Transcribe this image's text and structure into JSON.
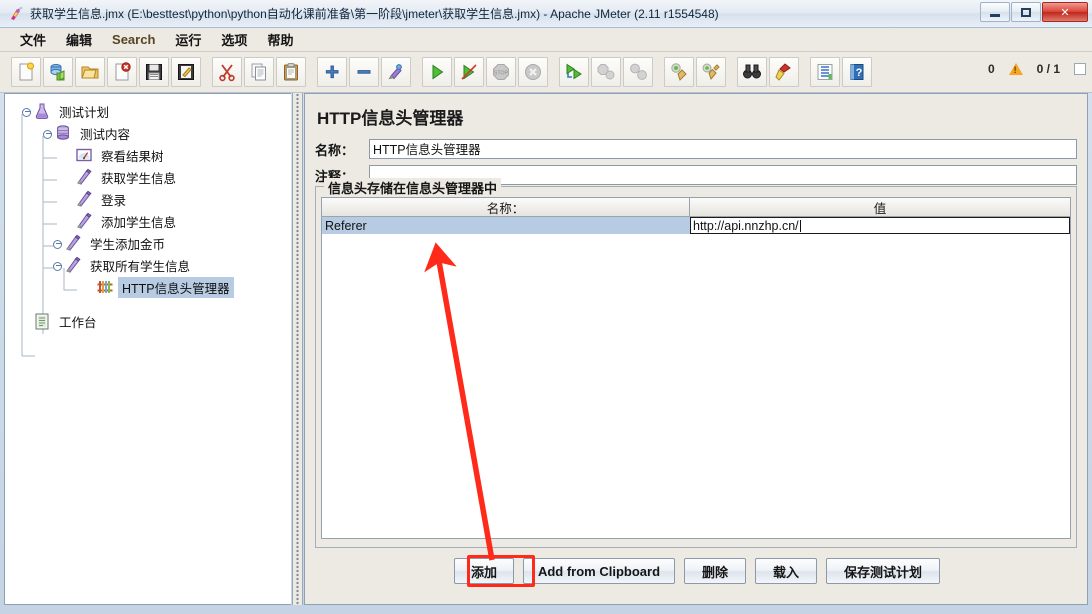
{
  "window": {
    "title": "获取学生信息.jmx (E:\\besttest\\python\\python自动化课前准备\\第一阶段\\jmeter\\获取学生信息.jmx) - Apache JMeter (2.11 r1554548)",
    "icon": "jmeter-flask-icon",
    "minimize_label": "",
    "maximize_label": "",
    "close_label": "✕"
  },
  "menu": {
    "items": [
      {
        "label": "文件",
        "name": "menu-file"
      },
      {
        "label": "编辑",
        "name": "menu-edit"
      },
      {
        "label": "Search",
        "name": "menu-search"
      },
      {
        "label": "运行",
        "name": "menu-run"
      },
      {
        "label": "选项",
        "name": "menu-options"
      },
      {
        "label": "帮助",
        "name": "menu-help"
      }
    ]
  },
  "toolbar": {
    "buttons": [
      {
        "icon": "new-document-icon"
      },
      {
        "icon": "templates-icon"
      },
      {
        "icon": "open-folder-icon"
      },
      {
        "icon": "close-document-icon"
      },
      {
        "icon": "save-icon"
      },
      {
        "icon": "save-as-icon"
      },
      {
        "sep": true
      },
      {
        "icon": "cut-scissors-icon"
      },
      {
        "icon": "copy-icon"
      },
      {
        "icon": "paste-clipboard-icon"
      },
      {
        "sep": true
      },
      {
        "icon": "expand-plus-icon"
      },
      {
        "icon": "collapse-minus-icon"
      },
      {
        "icon": "toggle-element-icon"
      },
      {
        "sep": true
      },
      {
        "icon": "start-play-icon"
      },
      {
        "icon": "start-no-timers-icon"
      },
      {
        "icon": "stop-icon"
      },
      {
        "icon": "shutdown-icon"
      },
      {
        "sep": true
      },
      {
        "icon": "remote-start-icon"
      },
      {
        "icon": "remote-stop-icon"
      },
      {
        "icon": "remote-shutdown-icon"
      },
      {
        "sep": true
      },
      {
        "icon": "clear-icon"
      },
      {
        "icon": "clear-all-icon"
      },
      {
        "sep": true
      },
      {
        "icon": "search-binoculars-icon"
      },
      {
        "icon": "reset-search-icon"
      },
      {
        "sep": true
      },
      {
        "icon": "function-helper-icon"
      },
      {
        "icon": "help-book-icon"
      }
    ],
    "warning_count": "0",
    "thread_counter": "0 / 1"
  },
  "tree": {
    "nodes": [
      {
        "label": "测试计划",
        "icon": "test-plan-flask-icon",
        "depth": 0,
        "expander": "expanded",
        "selected": false
      },
      {
        "label": "测试内容",
        "icon": "thread-group-icon",
        "depth": 1,
        "expander": "expanded",
        "selected": false
      },
      {
        "label": "察看结果树",
        "icon": "view-results-tree-icon",
        "depth": 2,
        "expander": "none",
        "selected": false
      },
      {
        "label": "获取学生信息",
        "icon": "http-sampler-icon",
        "depth": 2,
        "expander": "none",
        "selected": false
      },
      {
        "label": "登录",
        "icon": "http-sampler-icon",
        "depth": 2,
        "expander": "none",
        "selected": false
      },
      {
        "label": "添加学生信息",
        "icon": "http-sampler-icon",
        "depth": 2,
        "expander": "none",
        "selected": false
      },
      {
        "label": "学生添加金币",
        "icon": "http-sampler-icon",
        "depth": 2,
        "expander": "collapsed",
        "selected": false
      },
      {
        "label": "获取所有学生信息",
        "icon": "http-sampler-icon",
        "depth": 2,
        "expander": "expanded",
        "selected": false
      },
      {
        "label": "HTTP信息头管理器",
        "icon": "header-manager-icon",
        "depth": 3,
        "expander": "none",
        "selected": true
      },
      {
        "label": "工作台",
        "icon": "workbench-icon",
        "depth": 0,
        "expander": "none",
        "selected": false
      }
    ]
  },
  "panel": {
    "title": "HTTP信息头管理器",
    "name_label": "名称：",
    "name_value": "HTTP信息头管理器",
    "comment_label": "注释：",
    "comment_value": "",
    "group_title": "信息头存储在信息头管理器中",
    "table": {
      "columns": [
        "名称：",
        "值"
      ],
      "rows": [
        {
          "name": "Referer",
          "value": "http://api.nnzhp.cn/",
          "selected": true,
          "editing_cell": "value"
        }
      ]
    },
    "buttons": [
      {
        "label": "添加",
        "name": "add-button",
        "highlighted": true,
        "underline_index": -1
      },
      {
        "label": "Add from Clipboard",
        "name": "add-from-clipboard-button",
        "highlighted": false,
        "underline_char": "C"
      },
      {
        "label": "删除",
        "name": "delete-button",
        "highlighted": false,
        "underline_index": -1
      },
      {
        "label": "载入",
        "name": "load-button",
        "highlighted": false,
        "underline_index": -1
      },
      {
        "label": "保存测试计划",
        "name": "save-test-plan-button",
        "highlighted": false,
        "underline_index": -1
      }
    ]
  },
  "annotation": {
    "arrow_color": "#ff2a19",
    "highlight_color": "#ff2a19"
  }
}
